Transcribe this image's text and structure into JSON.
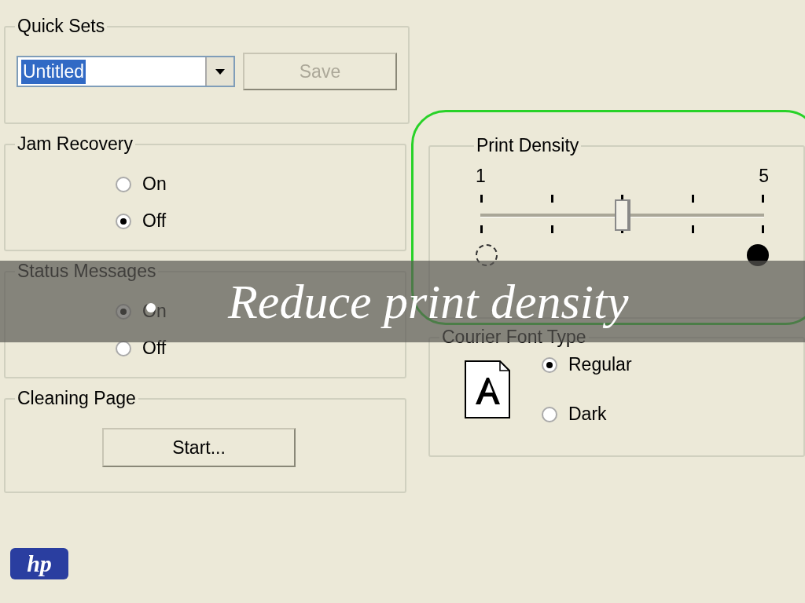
{
  "quick_sets": {
    "title": "Quick Sets",
    "dropdown_value": "Untitled",
    "value_selected": true,
    "save_button": {
      "label": "Save",
      "disabled": true
    }
  },
  "jam_recovery": {
    "title": "Jam Recovery",
    "options": [
      {
        "label": "On",
        "selected": false
      },
      {
        "label": "Off",
        "selected": true
      }
    ]
  },
  "status_messages": {
    "title": "Status Messages",
    "options": [
      {
        "label": "On",
        "selected": true
      },
      {
        "label": "Off",
        "selected": false
      }
    ]
  },
  "cleaning_page": {
    "title": "Cleaning Page",
    "button": "Start..."
  },
  "print_density": {
    "title": "Print Density",
    "min_label": "1",
    "max_label": "5",
    "level": 0.5,
    "highlighted": true
  },
  "courier_font_type": {
    "title": "Courier Font Type",
    "options": [
      {
        "label": "Regular",
        "selected": true
      },
      {
        "label": "Dark",
        "selected": false
      }
    ]
  },
  "logo": "hp",
  "caption": {
    "text": "Reduce print density"
  }
}
